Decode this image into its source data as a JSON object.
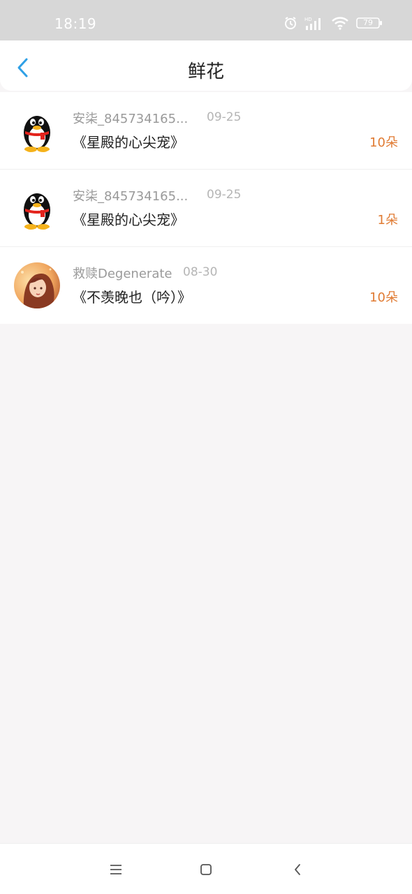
{
  "status_bar": {
    "time": "18:19",
    "battery": "79"
  },
  "header": {
    "title": "鲜花"
  },
  "records": [
    {
      "name": "安柒_845734165...",
      "date": "09-25",
      "book": "《星殿的心尖宠》",
      "count": "10朵",
      "avatar_icon": "qq-penguin-icon"
    },
    {
      "name": "安柒_845734165...",
      "date": "09-25",
      "book": "《星殿的心尖宠》",
      "count": "1朵",
      "avatar_icon": "qq-penguin-icon"
    },
    {
      "name": "救赎Degenerate",
      "date": "08-30",
      "book": "《不羡晚也（吟）》",
      "count": "10朵",
      "avatar_icon": "anime-girl-avatar"
    }
  ],
  "colors": {
    "accent": "#2fa0e6",
    "count": "#e07b33",
    "status_bar": "#d7d7d7",
    "page_bg": "#f7f5f6"
  }
}
